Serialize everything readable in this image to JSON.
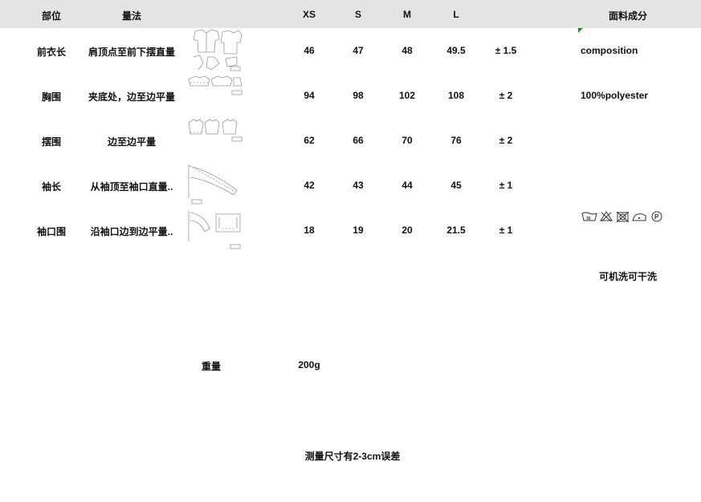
{
  "header": {
    "part": "部位",
    "method": "量法",
    "sizes": [
      "XS",
      "S",
      "M",
      "L"
    ],
    "material": "面料成分"
  },
  "rows": [
    {
      "part": "前衣长",
      "method": "肩顶点至前下摆直量",
      "values": [
        "46",
        "47",
        "48",
        "49.5"
      ],
      "tolerance": "± 1.5"
    },
    {
      "part": "胸围",
      "method": "夹底处，边至边平量",
      "values": [
        "94",
        "98",
        "102",
        "108"
      ],
      "tolerance": "± 2"
    },
    {
      "part": "摆围",
      "method": "边至边平量",
      "values": [
        "62",
        "66",
        "70",
        "76"
      ],
      "tolerance": "± 2"
    },
    {
      "part": "袖长",
      "method": "从袖顶至袖口直量..",
      "values": [
        "42",
        "43",
        "44",
        "45"
      ],
      "tolerance": "± 1"
    },
    {
      "part": "袖口围",
      "method": "沿袖口边到边平量..",
      "values": [
        "18",
        "19",
        "20",
        "21.5"
      ],
      "tolerance": "± 1"
    }
  ],
  "material": {
    "composition_label": "composition",
    "composition_value": "100%polyester",
    "care_icons": [
      "wash-30-icon",
      "no-bleach-icon",
      "no-tumble-dry-icon",
      "iron-low-icon",
      "dry-clean-p-icon"
    ],
    "care_text": "可机洗可干洗"
  },
  "weight": {
    "label": "重量",
    "value": "200g"
  },
  "note": "测量尺寸有2-3cm误差"
}
